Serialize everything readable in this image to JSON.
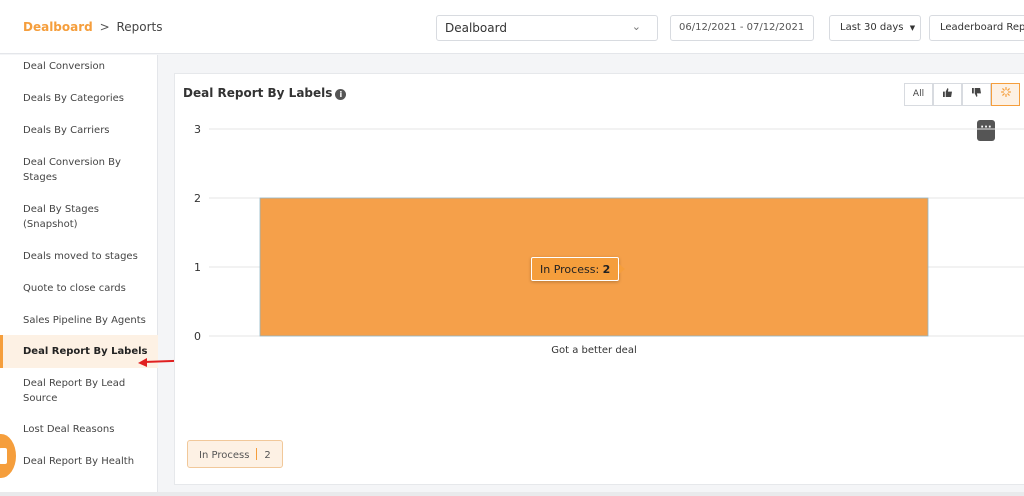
{
  "breadcrumb": {
    "root": "Dealboard",
    "separator": ">",
    "current": "Reports"
  },
  "header": {
    "board_select": {
      "value": "Dealboard"
    },
    "date_range": "06/12/2021 - 07/12/2021",
    "period_button": "Last 30 days",
    "report_button": "Leaderboard Rep"
  },
  "sidebar": {
    "items": [
      {
        "label": "Deal Conversion"
      },
      {
        "label": "Deals By Categories"
      },
      {
        "label": "Deals By Carriers"
      },
      {
        "label": "Deal Conversion By Stages"
      },
      {
        "label": "Deal By Stages (Snapshot)"
      },
      {
        "label": "Deals moved to stages"
      },
      {
        "label": "Quote to close cards"
      },
      {
        "label": "Sales Pipeline By Agents"
      },
      {
        "label": "Deal Report By Labels",
        "active": true
      },
      {
        "label": "Deal Report By Lead Source"
      },
      {
        "label": "Lost Deal Reasons"
      },
      {
        "label": "Deal Report By Health"
      }
    ]
  },
  "card": {
    "title": "Deal Report By Labels",
    "info_icon": "info-icon",
    "filters": [
      {
        "label": "All",
        "icon": ""
      },
      {
        "label": "",
        "icon": "thumbs-up-icon"
      },
      {
        "label": "",
        "icon": "thumbs-down-icon"
      },
      {
        "label": "",
        "icon": "spinner-icon",
        "active": true
      }
    ],
    "more_icon": "more-icon",
    "tooltip": {
      "label": "In Process:",
      "value": "2"
    },
    "legend": {
      "label": "In Process",
      "value": "2"
    }
  },
  "colors": {
    "accent": "#f59e3c",
    "bar": "#f5a04a"
  },
  "chart_data": {
    "type": "bar",
    "categories": [
      "Got a better deal"
    ],
    "series": [
      {
        "name": "In Process",
        "values": [
          2
        ]
      }
    ],
    "ylim": [
      0,
      3
    ],
    "yticks": [
      0,
      1,
      2,
      3
    ],
    "grid": true
  }
}
